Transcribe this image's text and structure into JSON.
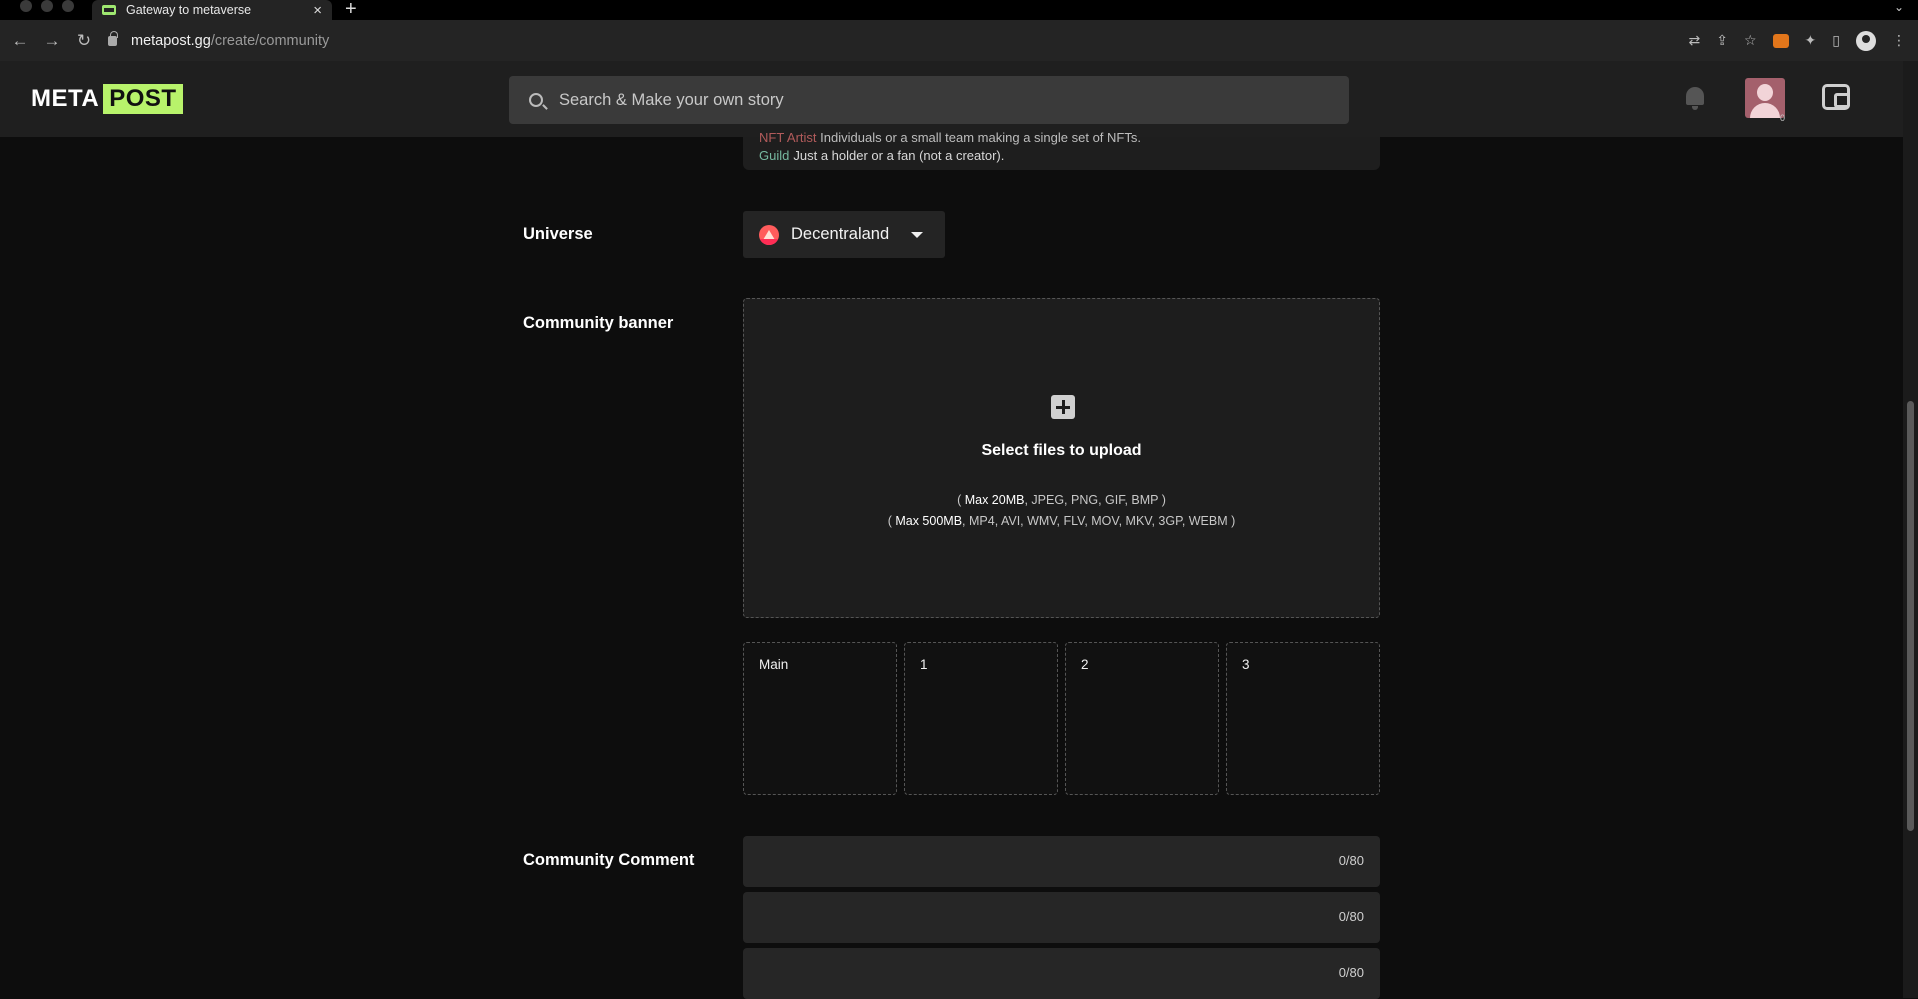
{
  "browser": {
    "tab_title": "Gateway to metaverse",
    "tab_close": "×",
    "new_tab": "+",
    "tab_menu": "⌄",
    "url_host": "metapost.gg",
    "url_path": "/create/community",
    "back": "←",
    "forward": "→",
    "reload": "↻",
    "translate_icon": "⇄",
    "share_icon": "⇪",
    "star_icon": "☆",
    "extensions_icon": "✦",
    "sidepanel_icon": "▯",
    "menu_icon": "⋮"
  },
  "header": {
    "logo_left": "META",
    "logo_right": "POST",
    "search_placeholder": "Search & Make your own story",
    "avatar_badge": "0"
  },
  "prev_section": {
    "artist_tag": "NFT Artist",
    "artist_desc": "Individuals or a small team making a single set of NFTs.",
    "guild_tag": "Guild",
    "guild_desc": "Just a holder or a fan (not a creator)."
  },
  "universe": {
    "label": "Universe",
    "selected": "Decentraland"
  },
  "banner": {
    "label": "Community banner",
    "upload_title": "Select files to upload",
    "image_limit_open": "( ",
    "image_limit_size": "Max 20MB",
    "image_limit_types": ", JPEG, PNG, GIF, BMP )",
    "video_limit_open": "( ",
    "video_limit_size": "Max 500MB",
    "video_limit_types": ", MP4, AVI, WMV, FLV, MOV, MKV, 3GP, WEBM )",
    "slots": [
      "Main",
      "1",
      "2",
      "3"
    ]
  },
  "comment": {
    "label": "Community Comment",
    "fields": [
      {
        "value": "",
        "counter": "0/80"
      },
      {
        "value": "",
        "counter": "0/80"
      },
      {
        "value": "",
        "counter": "0/80"
      }
    ]
  },
  "colors": {
    "logo_accent": "#b8f36b",
    "background": "#0d0d0d",
    "header_bg": "#1f1f1f",
    "field_bg": "#262626"
  }
}
